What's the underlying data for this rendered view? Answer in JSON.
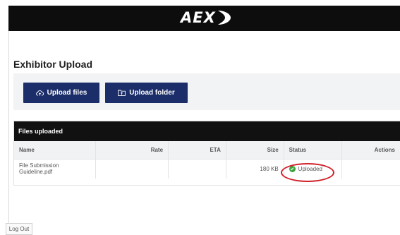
{
  "header": {
    "logo": "AEX"
  },
  "page": {
    "title": "Exhibitor Upload"
  },
  "upload": {
    "files_label": "Upload files",
    "folder_label": "Upload folder"
  },
  "files": {
    "header": "Files uploaded",
    "columns": {
      "name": "Name",
      "rate": "Rate",
      "eta": "ETA",
      "size": "Size",
      "status": "Status",
      "actions": "Actions"
    },
    "rows": [
      {
        "name": "File Submission Guideline.pdf",
        "rate": "",
        "eta": "",
        "size": "180 KB",
        "status": "Uploaded",
        "status_color": "#3ba33b"
      }
    ]
  },
  "footer": {
    "logout_label": "Log Out"
  },
  "colors": {
    "topbar": "#0d0d0d",
    "button": "#1c2e6a",
    "highlight": "#d0202a"
  }
}
